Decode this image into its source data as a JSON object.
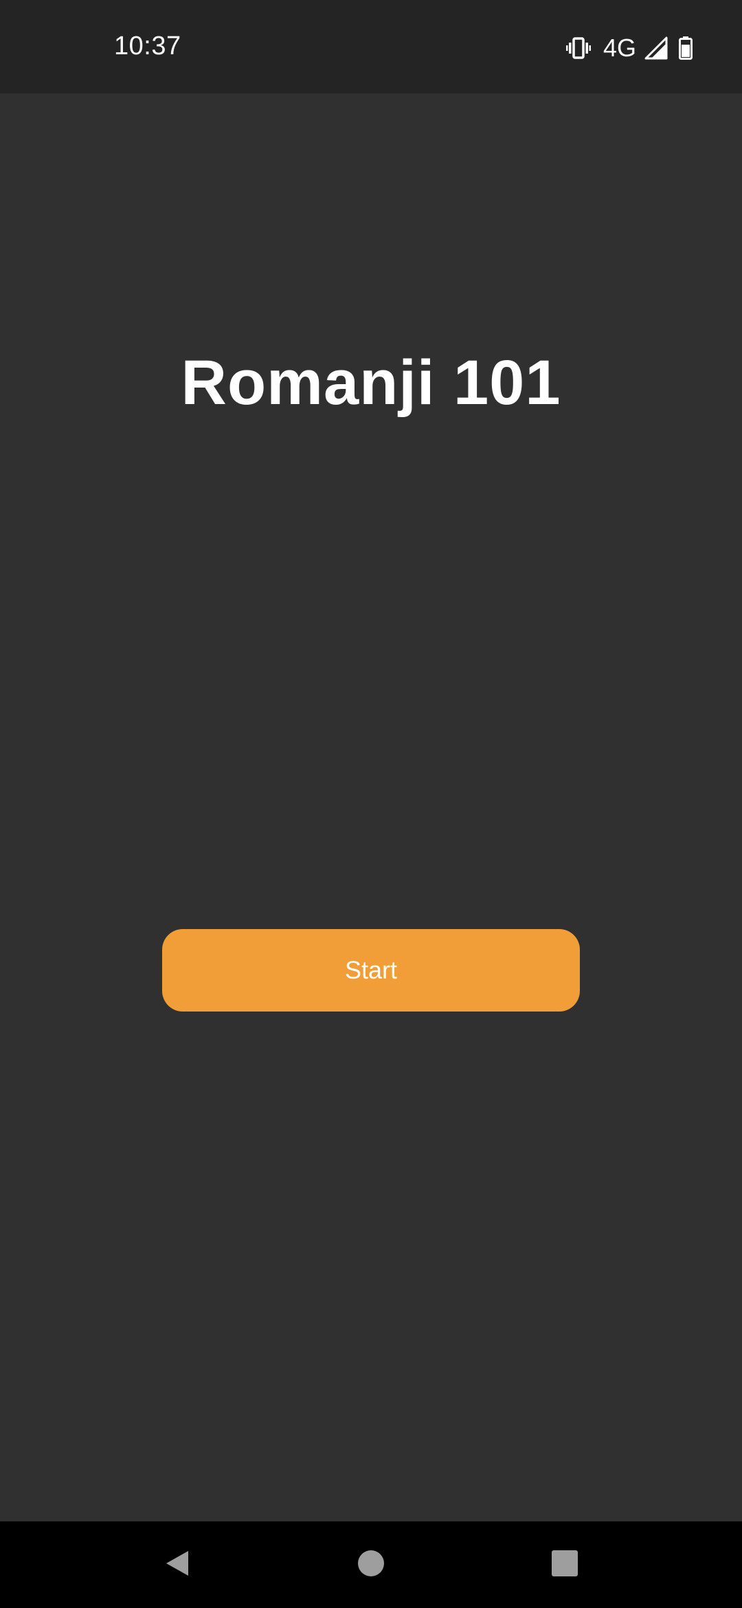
{
  "status_bar": {
    "time": "10:37",
    "network": "4G",
    "icons": [
      "vibrate-icon",
      "signal-icon",
      "battery-icon"
    ]
  },
  "main": {
    "title": "Romanji 101",
    "start_label": "Start"
  },
  "nav_bar": {
    "icons": [
      "back-icon",
      "home-icon",
      "recents-icon"
    ]
  },
  "colors": {
    "background": "#303030",
    "status_bar": "#242424",
    "accent": "#f19d38",
    "nav_bar": "#000000",
    "nav_icon": "#9e9e9e"
  }
}
